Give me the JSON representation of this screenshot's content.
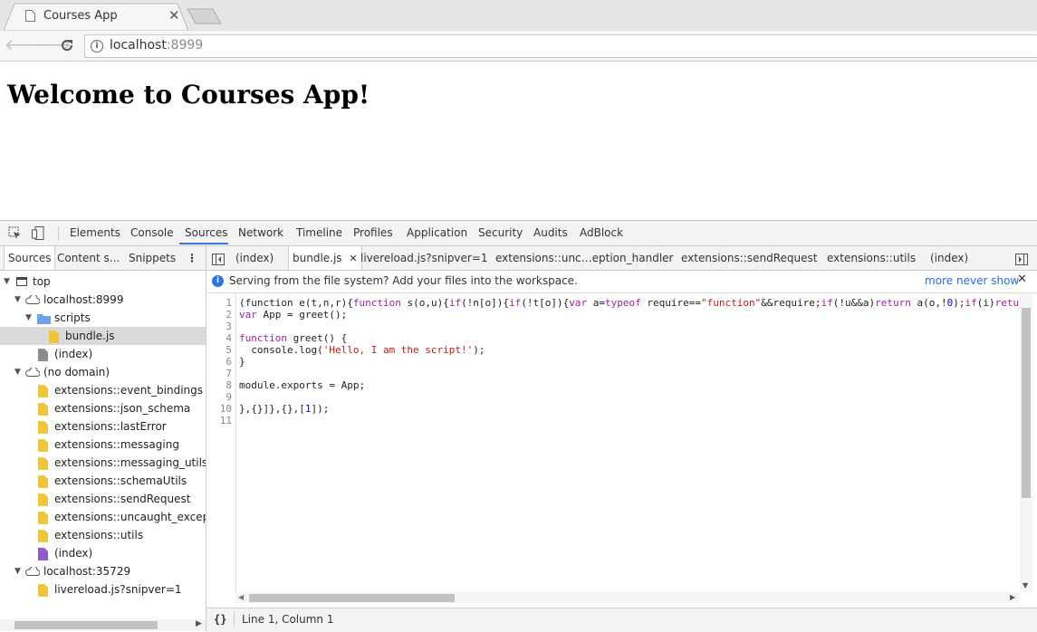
{
  "browser": {
    "tab_title": "Courses App",
    "url_host": "localhost",
    "url_port": ":8999"
  },
  "page": {
    "heading": "Welcome to Courses App!"
  },
  "devtools": {
    "tabs": [
      "Elements",
      "Console",
      "Sources",
      "Network",
      "Timeline",
      "Profiles",
      "Application",
      "Security",
      "Audits",
      "AdBlock"
    ],
    "active_tab": "Sources",
    "navigator": {
      "tabs": [
        "Sources",
        "Content s...",
        "Snippets"
      ],
      "tree": {
        "top": "top",
        "origin1": "localhost:8999",
        "scripts_folder": "scripts",
        "bundle_file": "bundle.js",
        "index1": "(index)",
        "no_domain": "(no domain)",
        "extensions": [
          "extensions::event_bindings",
          "extensions::json_schema",
          "extensions::lastError",
          "extensions::messaging",
          "extensions::messaging_utils",
          "extensions::schemaUtils",
          "extensions::sendRequest",
          "extensions::uncaught_exceptio",
          "extensions::utils"
        ],
        "index2": "(index)",
        "origin2": "localhost:35729",
        "livereload_file": "livereload.js?snipver=1"
      }
    },
    "editor": {
      "tabs": [
        "(index)",
        "bundle.js",
        "livereload.js?snipver=1",
        "extensions::unc…eption_handler",
        "extensions::sendRequest",
        "extensions::utils",
        "(index)"
      ],
      "active_tab": "bundle.js",
      "infobar": {
        "message": "Serving from the file system? Add your files into the workspace.",
        "more_link": "more",
        "never_link": "never show"
      },
      "line_numbers": [
        "1",
        "2",
        "3",
        "4",
        "5",
        "6",
        "7",
        "8",
        "9",
        "10",
        "11"
      ],
      "status": "Line 1, Column 1",
      "format_button": "{}"
    }
  }
}
